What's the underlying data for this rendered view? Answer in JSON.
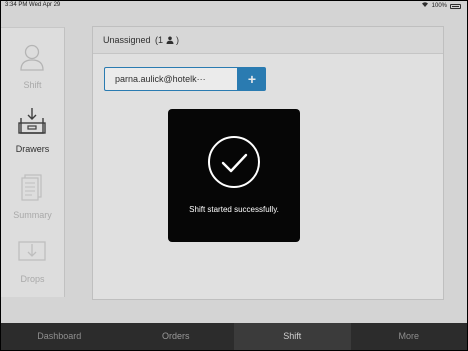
{
  "status_bar": {
    "time_date": "3:34 PM  Wed Apr 29",
    "battery": "100%"
  },
  "sidebar": {
    "items": [
      {
        "label": "Shift",
        "icon": "user-icon"
      },
      {
        "label": "Drawers",
        "icon": "drawer-icon"
      },
      {
        "label": "Summary",
        "icon": "document-icon"
      },
      {
        "label": "Drops",
        "icon": "drop-icon"
      }
    ],
    "active": "Drawers"
  },
  "panel": {
    "title": "Unassigned",
    "count": "(1",
    "count_suffix": ")",
    "user_value": "parna.aulick@hotelk···",
    "add_label": "+"
  },
  "toast": {
    "message": "Shift started successfully."
  },
  "tabs": [
    "Dashboard",
    "Orders",
    "Shift",
    "More"
  ],
  "active_tab": "Shift",
  "colors": {
    "accent": "#2e86c1",
    "tabbar": "#2c2c2c",
    "toast_bg": "#060606"
  }
}
